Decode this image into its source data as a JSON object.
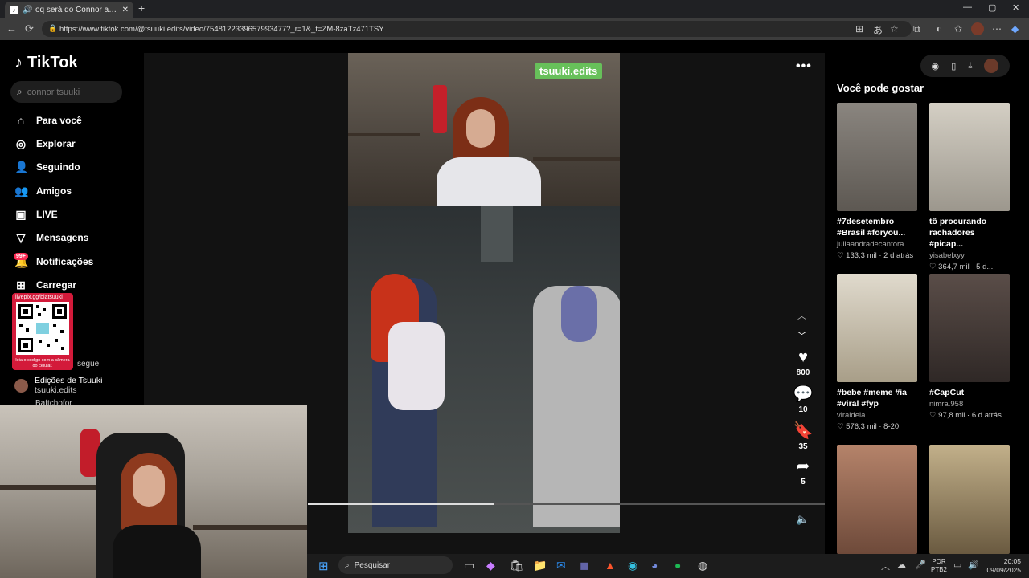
{
  "browser": {
    "tab_title": "oq será do Connor agora ? 🎤",
    "url": "https://www.tiktok.com/@tsuuki.edits/video/7548122339657993477?_r=1&_t=ZM-8zaTz471TSY"
  },
  "sidebar": {
    "logo": "TikTok",
    "search_placeholder": "connor tsuuki",
    "items": [
      {
        "label": "Para você",
        "icon": "home-icon"
      },
      {
        "label": "Explorar",
        "icon": "compass-icon"
      },
      {
        "label": "Seguindo",
        "icon": "following-icon"
      },
      {
        "label": "Amigos",
        "icon": "friends-icon"
      },
      {
        "label": "LIVE",
        "icon": "live-icon"
      },
      {
        "label": "Mensagens",
        "icon": "message-icon"
      },
      {
        "label": "Notificações",
        "icon": "bell-icon"
      },
      {
        "label": "Carregar",
        "icon": "upload-icon"
      }
    ],
    "notification_badge": "99+",
    "qr": {
      "top_text": "livepix.gg/biatsuuki",
      "bottom_text": "leia o código com a câmera do celular."
    },
    "following_label": "segue",
    "account": {
      "name": "Edições de Tsuuki",
      "handle": "tsuuki.edits"
    },
    "account2_partial": "Baftchofor"
  },
  "video": {
    "watermark": "tsuuki.edits",
    "likes": "800",
    "comments": "10",
    "saves": "35",
    "shares": "5",
    "progress": 0.36
  },
  "recommendations": {
    "title": "Você pode gostar",
    "cards": [
      {
        "caption": "#7desetembro #Brasil #foryou...",
        "author": "juliaandradecantora",
        "likes": "133,3 mil",
        "date": "2 d atrás",
        "color": "#6d6a66"
      },
      {
        "caption": "tô procurando rachadores #picap...",
        "author": "yisabelxyy",
        "likes": "364,7 mil",
        "date": "5 d...",
        "color": "#b7b2a8"
      },
      {
        "caption": "#bebe #meme #ia #viral #fyp",
        "author": "viraldeia",
        "likes": "576,3 mil",
        "date": "8-20",
        "color": "#c6c0b2"
      },
      {
        "caption": "#CapCut",
        "author": "nimra.958",
        "likes": "97,8 mil",
        "date": "6 d atrás",
        "color": "#4e4440"
      },
      {
        "caption": "",
        "author": "",
        "likes": "",
        "date": "",
        "color": "#8f6e5c"
      },
      {
        "caption": "",
        "author": "",
        "likes": "",
        "date": "",
        "color": "#9b8c6a"
      }
    ]
  },
  "taskbar": {
    "search_label": "Pesquisar",
    "lang_line1": "POR",
    "lang_line2": "PTB2",
    "time": "20:05",
    "date": "09/09/2025"
  }
}
